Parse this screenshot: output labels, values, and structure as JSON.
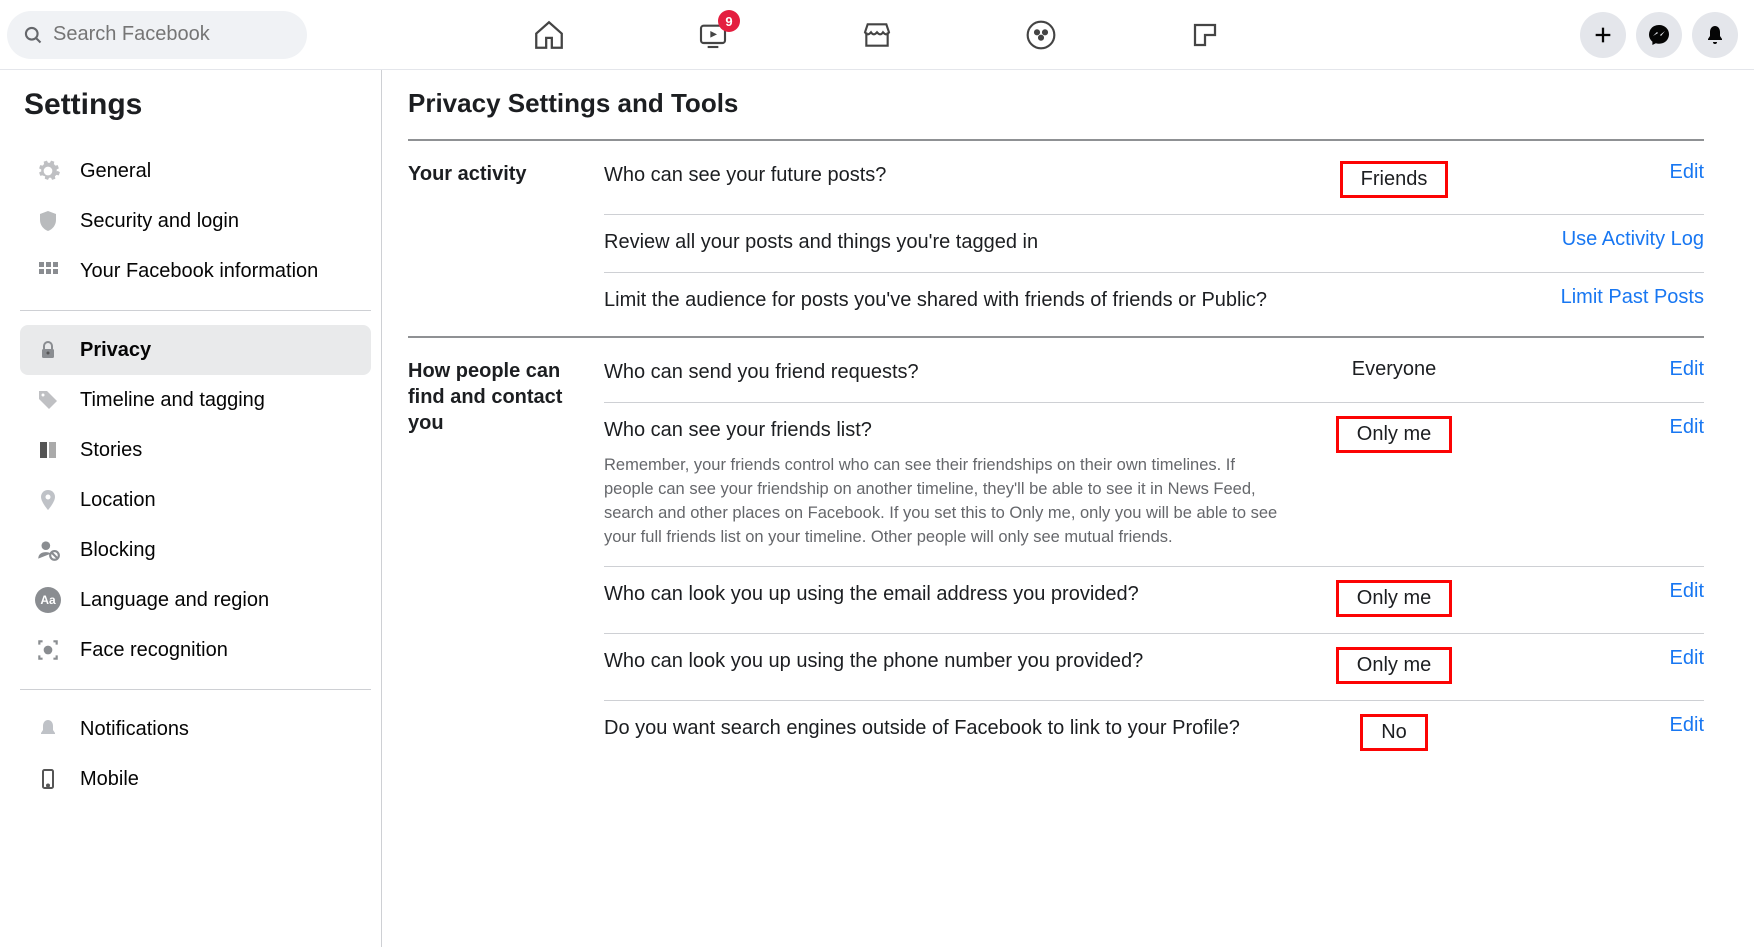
{
  "search": {
    "placeholder": "Search Facebook"
  },
  "topnav": {
    "watch_badge": "9"
  },
  "sidebar": {
    "title": "Settings",
    "items": [
      {
        "label": "General"
      },
      {
        "label": "Security and login"
      },
      {
        "label": "Your Facebook information"
      },
      {
        "label": "Privacy"
      },
      {
        "label": "Timeline and tagging"
      },
      {
        "label": "Stories"
      },
      {
        "label": "Location"
      },
      {
        "label": "Blocking"
      },
      {
        "label": "Language and region"
      },
      {
        "label": "Face recognition"
      },
      {
        "label": "Notifications"
      },
      {
        "label": "Mobile"
      }
    ]
  },
  "main": {
    "title": "Privacy Settings and Tools",
    "sections": [
      {
        "label": "Your activity",
        "rows": [
          {
            "text": "Who can see your future posts?",
            "value": "Friends",
            "highlight": true,
            "action": "Edit"
          },
          {
            "text": "Review all your posts and things you're tagged in",
            "value": "",
            "action": "Use Activity Log"
          },
          {
            "text": "Limit the audience for posts you've shared with friends of friends or Public?",
            "value": "",
            "action": "Limit Past Posts"
          }
        ]
      },
      {
        "label": "How people can find and contact you",
        "rows": [
          {
            "text": "Who can send you friend requests?",
            "value": "Everyone",
            "highlight": false,
            "action": "Edit"
          },
          {
            "text": "Who can see your friends list?",
            "sub": "Remember, your friends control who can see their friendships on their own timelines. If people can see your friendship on another timeline, they'll be able to see it in News Feed, search and other places on Facebook. If you set this to Only me, only you will be able to see your full friends list on your timeline. Other people will only see mutual friends.",
            "value": "Only me",
            "highlight": true,
            "action": "Edit"
          },
          {
            "text": "Who can look you up using the email address you provided?",
            "value": "Only me",
            "highlight": true,
            "action": "Edit"
          },
          {
            "text": "Who can look you up using the phone number you provided?",
            "value": "Only me",
            "highlight": true,
            "action": "Edit"
          },
          {
            "text": "Do you want search engines outside of Facebook to link to your Profile?",
            "value": "No",
            "highlight": true,
            "action": "Edit"
          }
        ]
      }
    ]
  }
}
